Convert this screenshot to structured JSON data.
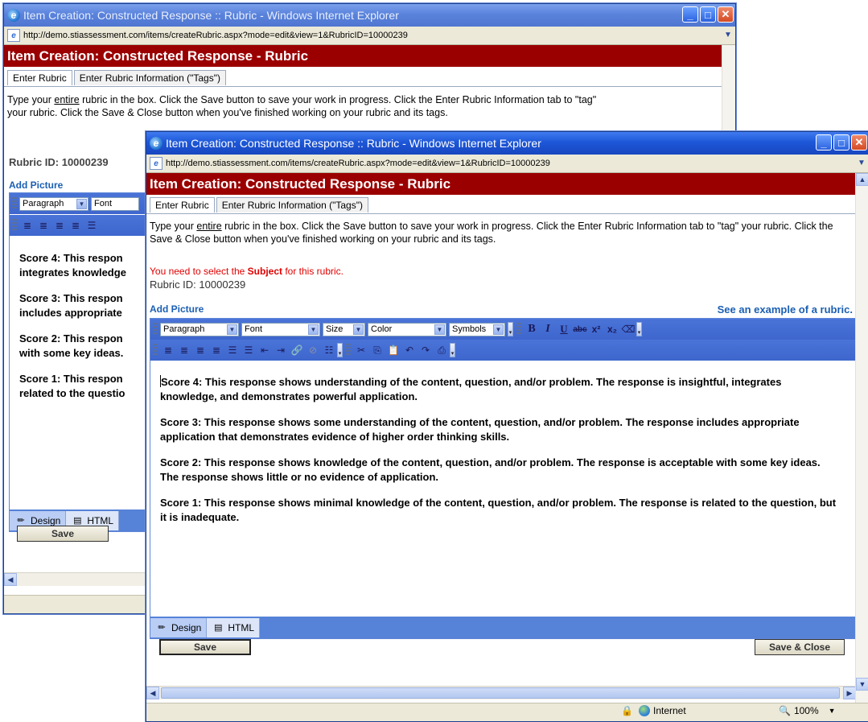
{
  "browser": {
    "window_title": "Item Creation: Constructed Response :: Rubric - Windows Internet Explorer",
    "url": "http://demo.stiassessment.com/items/createRubric.aspx?mode=edit&view=1&RubricID=10000239",
    "status_zone": "Internet",
    "zoom": "100%"
  },
  "page": {
    "header": "Item Creation: Constructed Response - Rubric",
    "tabs": [
      {
        "label": "Enter Rubric"
      },
      {
        "label": "Enter Rubric Information (\"Tags\")"
      }
    ],
    "instructions_pre": "Type your ",
    "instructions_underline": "entire",
    "instructions_post": " rubric in the box. Click the Save button to save your work in progress. Click the Enter Rubric Information tab to \"tag\" your rubric. Click the Save & Close button when you've finished working on your rubric and its tags.",
    "warning_pre": "You need to select the ",
    "warning_bold": "Subject",
    "warning_post": " for this rubric.",
    "rubric_id_label": "Rubric ID:",
    "rubric_id_value": "10000239",
    "add_picture": "Add Picture",
    "example_link": "See an example of a rubric."
  },
  "toolbar": {
    "paragraph": "Paragraph",
    "font": "Font",
    "size": "Size",
    "color": "Color",
    "symbols": "Symbols"
  },
  "editor": {
    "scores": [
      "Score 4:  This response shows understanding of the content, question, and/or problem. The response is insightful, integrates knowledge, and demonstrates powerful application.",
      "Score 3:  This response shows some understanding of the content, question, and/or problem. The response includes appropriate application that demonstrates evidence of higher order thinking skills.",
      "Score 2:  This response shows knowledge of the content, question, and/or problem. The response is acceptable with some key ideas. The response shows little or no evidence of application.",
      "Score 1:  This response shows minimal knowledge of the content, question, and/or problem. The response is related to the question, but it is inadequate."
    ],
    "back_scores": [
      "Score 4:  This respon",
      "integrates knowledge",
      "Score 3:  This respon",
      "includes appropriate",
      "Score 2:  This respon",
      "with some key ideas.",
      "Score 1:  This respon",
      "related to the questio"
    ],
    "mode_design": "Design",
    "mode_html": "HTML"
  },
  "buttons": {
    "save": "Save",
    "save_close": "Save & Close"
  },
  "back_window": {
    "title": "Item Creation: Constructed Response :: Rubric - Windows Internet Explorer",
    "url": "http://demo.stiassessment.com/items/createRubric.aspx?mode=edit&view=1&RubricID=10000239",
    "instructions_line1_pre": "Type your ",
    "instructions_line1_underline": "entire",
    "instructions_line1_post": " rubric in the box. Click the Save button to save your work in progress. Click the Enter Rubric Information tab to \"tag\"",
    "instructions_line2": "your rubric. Click the Save & Close button when you've finished working on your rubric and its tags.",
    "rubric_id": "Rubric ID: 10000239",
    "paragraph": "Paragraph",
    "font": "Font"
  }
}
